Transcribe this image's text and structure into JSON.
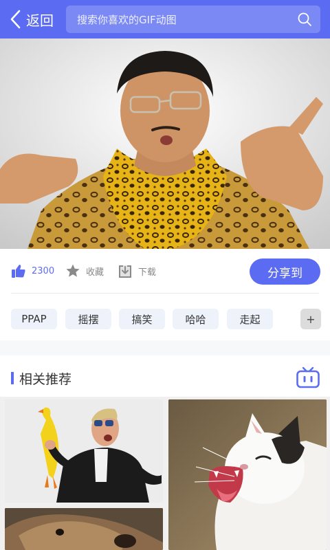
{
  "header": {
    "back_label": "返回",
    "search_placeholder": "搜索你喜欢的GIF动图",
    "back_icon": "chevron-left-icon",
    "search_icon": "search-icon",
    "bg_color": "#5b6cf2"
  },
  "actions": {
    "like_count": "2300",
    "favorite_label": "收藏",
    "download_label": "下载",
    "share_label": "分享到",
    "accent_color": "#5b6cf2"
  },
  "tags": [
    "PPAP",
    "摇摆",
    "搞笑",
    "哈哈",
    "走起"
  ],
  "tag_add_label": "+",
  "related": {
    "title": "相关推荐",
    "icon": "tv-icon"
  }
}
